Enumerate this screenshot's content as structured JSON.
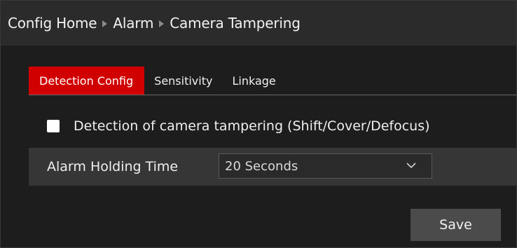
{
  "breadcrumb": {
    "items": [
      "Config Home",
      "Alarm",
      "Camera Tampering"
    ]
  },
  "tabs": [
    {
      "label": "Detection Config",
      "active": true
    },
    {
      "label": "Sensitivity",
      "active": false
    },
    {
      "label": "Linkage",
      "active": false
    }
  ],
  "detection": {
    "checkbox_label": "Detection of camera tampering (Shift/Cover/Defocus)",
    "checked": false
  },
  "holding_time": {
    "label": "Alarm Holding Time",
    "value": "20 Seconds"
  },
  "actions": {
    "save_label": "Save"
  },
  "colors": {
    "accent": "#d10000",
    "header_bg": "#2b2b2b",
    "panel_bg": "#363636",
    "page_bg": "#1d1d1d"
  },
  "icons": {
    "breadcrumb_separator": "triangle-right-icon",
    "dropdown": "chevron-down-icon"
  }
}
